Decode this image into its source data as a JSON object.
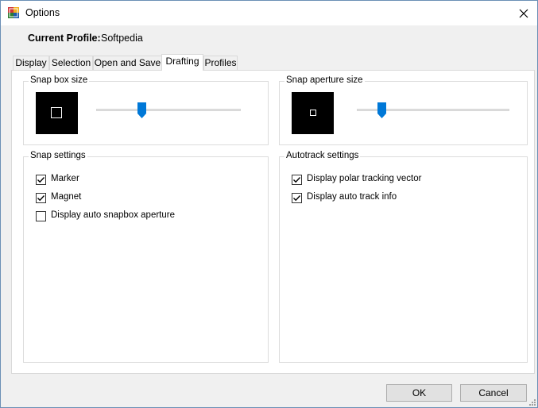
{
  "window": {
    "title": "Options"
  },
  "profile": {
    "label": "Current Profile:",
    "value": "Softpedia"
  },
  "tabs": [
    {
      "label": "Display",
      "active": false
    },
    {
      "label": "Selection",
      "active": false
    },
    {
      "label": "Open and Save",
      "active": false
    },
    {
      "label": "Drafting",
      "active": true
    },
    {
      "label": "Profiles",
      "active": false
    }
  ],
  "snap_box": {
    "title": "Snap box size",
    "slider_level": 0.32
  },
  "snap_aperture": {
    "title": "Snap aperture size",
    "slider_level": 0.16
  },
  "snap_settings": {
    "title": "Snap settings",
    "items": [
      {
        "label": "Marker",
        "checked": true
      },
      {
        "label": "Magnet",
        "checked": true
      },
      {
        "label": "Display auto snapbox aperture",
        "checked": false
      }
    ]
  },
  "autotrack_settings": {
    "title": "Autotrack settings",
    "items": [
      {
        "label": "Display polar tracking vector",
        "checked": true
      },
      {
        "label": "Display auto track info",
        "checked": true
      }
    ]
  },
  "buttons": {
    "ok": "OK",
    "cancel": "Cancel"
  },
  "colors": {
    "slider_thumb": "#0078d7",
    "preview_bg": "#000000"
  },
  "icons": {
    "app": "options-app-icon",
    "close": "close-icon",
    "check": "checkmark-icon",
    "grip": "resize-grip-icon"
  }
}
